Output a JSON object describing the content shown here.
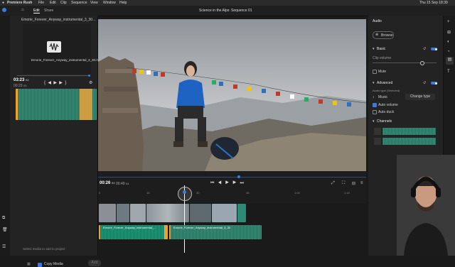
{
  "menubar": {
    "app_name": "Premiere Rush",
    "items": [
      "File",
      "Edit",
      "Clip",
      "Sequence",
      "View",
      "Window",
      "Help"
    ],
    "clock": "Thu 15 Sep  18:39"
  },
  "appbar": {
    "tabs": [
      {
        "label": "Edit"
      },
      {
        "label": "Share"
      }
    ],
    "title": "Science in the Alps: Sequence 01"
  },
  "media": {
    "file_header": "Emorie_Forever_Anyway_instrumental_3_30...",
    "file_name": "Emorie_Forever_Anyway_instrumental_3_30.mp3",
    "current_time": "03:23",
    "current_frames": "04",
    "duration_time": "00:23",
    "duration_frames": "03",
    "empty_text": "Select media to add to project",
    "copy_media_label": "Copy Media",
    "add_label": "Add"
  },
  "timeline": {
    "current_time": "00:26",
    "current_frames": "03",
    "duration": "00:49",
    "duration_frames": "04",
    "ruler_labels": [
      "0",
      "15",
      "30",
      "45",
      "1:00",
      "1:15"
    ],
    "audio_clip_1": "Emorie_Forever_Anyway_instrumental_...",
    "audio_clip_2": "Emorie_Forever_Anyway_instrumental_3_30"
  },
  "audio_panel": {
    "title": "Audio",
    "browse_label": "Browse",
    "basic_label": "Basic",
    "clip_volume_label": "Clip volume",
    "clip_volume_level": 0.78,
    "mute_label": "Mute",
    "advanced_label": "Advanced",
    "audio_type_label": "Audio type (Selected)",
    "music_label": "Music",
    "change_type_label": "Change type",
    "auto_volume_label": "Auto volume",
    "auto_duck_label": "Auto duck",
    "channels_label": "Channels"
  },
  "colors": {
    "accent": "#3a7be0",
    "audio_clip": "#2d9d7f",
    "clip_edge": "#f0a030",
    "flag_red": "#c0392b"
  }
}
